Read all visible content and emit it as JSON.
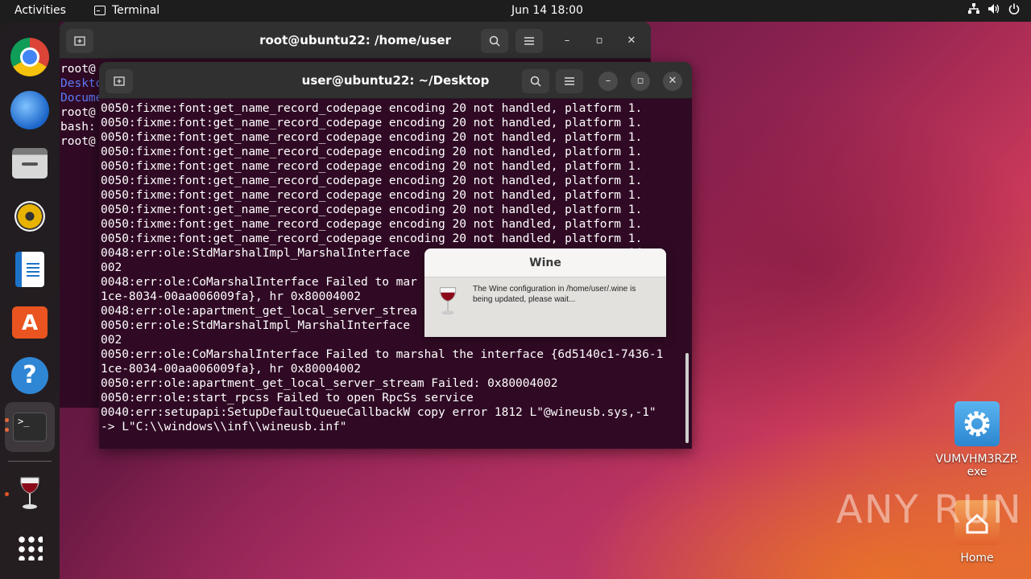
{
  "topbar": {
    "activities": "Activities",
    "app_name": "Terminal",
    "clock": "Jun 14  18:00",
    "status_icons": [
      "network-icon",
      "volume-icon",
      "power-icon"
    ]
  },
  "dock": {
    "items": [
      {
        "name": "chrome"
      },
      {
        "name": "thunderbird"
      },
      {
        "name": "files"
      },
      {
        "name": "rhythmbox"
      },
      {
        "name": "libreoffice-writer"
      },
      {
        "name": "app-center"
      },
      {
        "name": "help"
      },
      {
        "name": "terminal",
        "active": true
      },
      {
        "name": "wine"
      },
      {
        "name": "show-apps"
      }
    ],
    "terminal_prompt_glyph": ">_"
  },
  "back_window": {
    "title": "root@ubuntu22: /home/user",
    "lines": [
      {
        "text": "root@",
        "color": "white"
      },
      {
        "text": "Deskto",
        "color": "blue"
      },
      {
        "text": "Docume",
        "color": "blue"
      },
      {
        "text": "root@",
        "color": "white"
      },
      {
        "text": "bash:",
        "color": "white"
      },
      {
        "text": "root@",
        "color": "white"
      }
    ]
  },
  "front_window": {
    "title": "user@ubuntu22: ~/Desktop",
    "terminal_text": "0050:fixme:font:get_name_record_codepage encoding 20 not handled, platform 1.\n0050:fixme:font:get_name_record_codepage encoding 20 not handled, platform 1.\n0050:fixme:font:get_name_record_codepage encoding 20 not handled, platform 1.\n0050:fixme:font:get_name_record_codepage encoding 20 not handled, platform 1.\n0050:fixme:font:get_name_record_codepage encoding 20 not handled, platform 1.\n0050:fixme:font:get_name_record_codepage encoding 20 not handled, platform 1.\n0050:fixme:font:get_name_record_codepage encoding 20 not handled, platform 1.\n0050:fixme:font:get_name_record_codepage encoding 20 not handled, platform 1.\n0050:fixme:font:get_name_record_codepage encoding 20 not handled, platform 1.\n0050:fixme:font:get_name_record_codepage encoding 20 not handled, platform 1.\n0048:err:ole:StdMarshalImpl_MarshalInterface                               04\n002\n0048:err:ole:CoMarshalInterface Failed to mar                              -1\n1ce-8034-00aa006009fa}, hr 0x80004002\n0048:err:ole:apartment_get_local_server_strea\n0050:err:ole:StdMarshalImpl_MarshalInterface                               04\n002\n0050:err:ole:CoMarshalInterface Failed to marshal the interface {6d5140c1-7436-1\n1ce-8034-00aa006009fa}, hr 0x80004002\n0050:err:ole:apartment_get_local_server_stream Failed: 0x80004002\n0050:err:ole:start_rpcss Failed to open RpcSs service\n0040:err:setupapi:SetupDefaultQueueCallbackW copy error 1812 L\"@wineusb.sys,-1\"\n-> L\"C:\\\\windows\\\\inf\\\\wineusb.inf\""
  },
  "wine_dialog": {
    "title": "Wine",
    "message": "The Wine configuration in /home/user/.wine is being updated, please wait..."
  },
  "desktop": {
    "icons": [
      {
        "label": "VUMVHM3RZP.\nexe",
        "icon": "gear-icon"
      },
      {
        "label": "Home",
        "icon": "home-folder-icon"
      }
    ]
  },
  "watermark": "ANY RUN",
  "colors": {
    "terminal_bg": "#300a24",
    "accent": "#e95420",
    "dir_blue": "#5c7cfa"
  }
}
